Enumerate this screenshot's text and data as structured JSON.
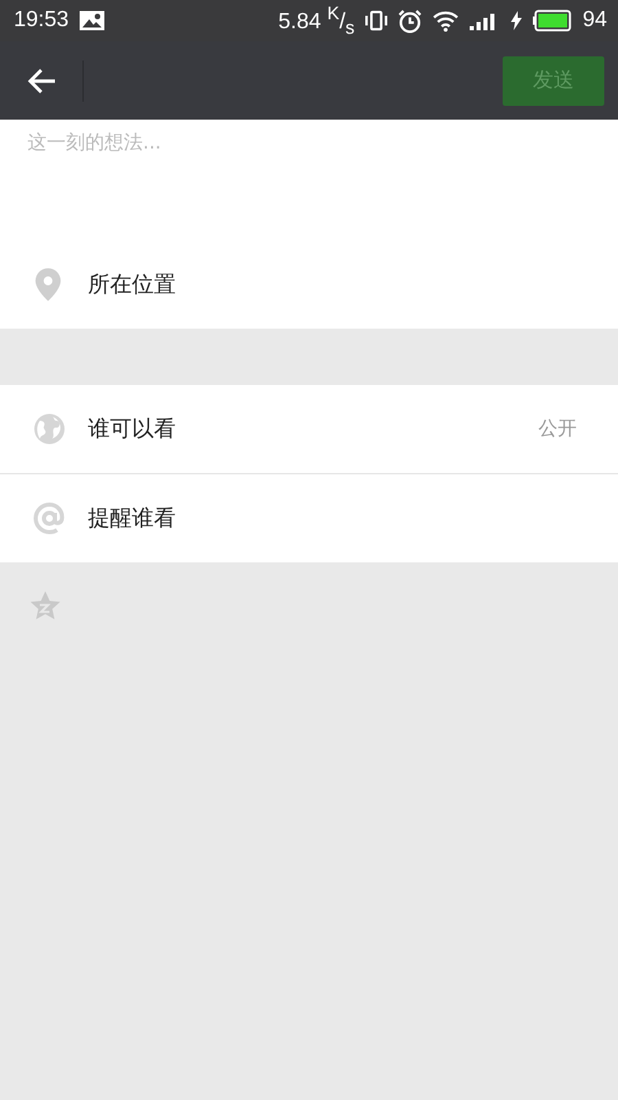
{
  "status_bar": {
    "time": "19:53",
    "speed": "5.84 $^{K}$/$_{s}$",
    "battery": "94"
  },
  "toolbar": {
    "send_button": {
      "label": "发送",
      "disabled": true
    }
  },
  "compose": {
    "placeholder": "这一刻的想法..."
  },
  "location": {
    "kind": "location",
    "label": "所在位置"
  },
  "options": [
    {
      "kind": "globe",
      "label": "谁可以看",
      "value": "公开"
    },
    {
      "kind": "mention",
      "label": "提醒谁看"
    }
  ],
  "footer": {
    "kind": "star"
  }
}
